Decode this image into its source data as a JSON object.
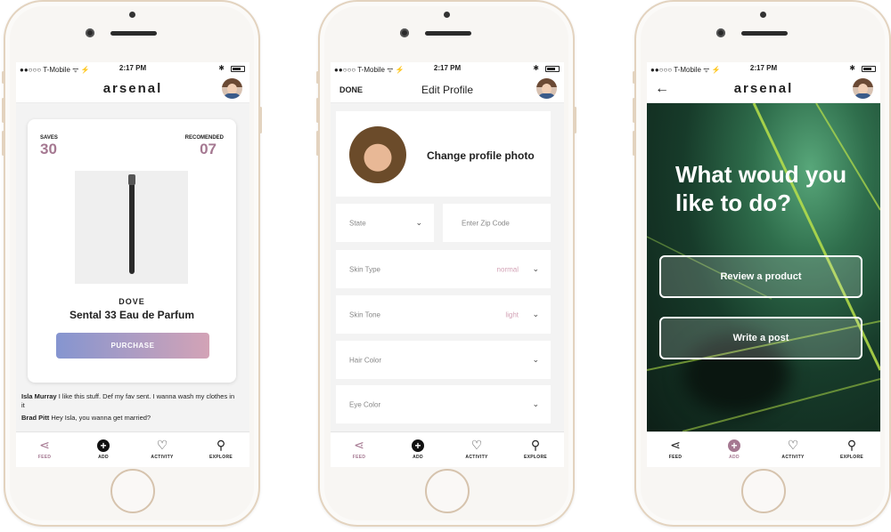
{
  "status": {
    "carrier": "●●○○○ T-Mobile ᯤ ⚡",
    "time": "2:17 PM",
    "bt": "✱"
  },
  "app": {
    "logo": "arsenal"
  },
  "feed": {
    "saves_label": "SAVES",
    "saves_value": "30",
    "recommended_label": "RECOMENDED",
    "recommended_value": "07",
    "brand": "DOVE",
    "product_name": "Sental 33 Eau de Parfum",
    "purchase_label": "PURCHASE",
    "comments": [
      {
        "user": "Isla Murray",
        "text": "I like this stuff. Def my fav sent. I wanna wash my clothes in it"
      },
      {
        "user": "Brad Pitt",
        "text": "Hey Isla, you wanna get married?"
      }
    ]
  },
  "tabs": [
    {
      "label": "FEED",
      "icon": "feed-icon"
    },
    {
      "label": "ADD",
      "icon": "add-icon"
    },
    {
      "label": "ACTIVITY",
      "icon": "heart-icon"
    },
    {
      "label": "EXPLORE",
      "icon": "search-icon"
    }
  ],
  "edit_profile": {
    "done_label": "DONE",
    "title": "Edit Profile",
    "change_photo": "Change profile photo",
    "state_label": "State",
    "zip_placeholder": "Enter Zip Code",
    "fields": [
      {
        "label": "Skin Type",
        "value": "normal"
      },
      {
        "label": "Skin Tone",
        "value": "light"
      },
      {
        "label": "Hair Color",
        "value": ""
      },
      {
        "label": "Eye Color",
        "value": ""
      }
    ]
  },
  "action": {
    "question": "What woud you like to do?",
    "review_label": "Review a product",
    "write_label": "Write a post"
  },
  "colors": {
    "accent": "#a57891",
    "gradient_start": "#8595d0",
    "gradient_end": "#d3a3b6"
  }
}
